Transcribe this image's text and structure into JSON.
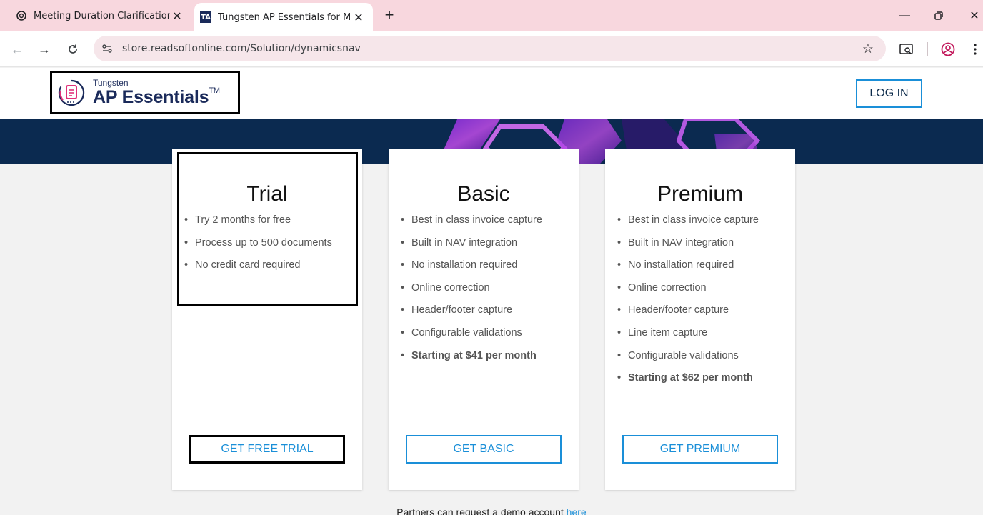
{
  "browser": {
    "tabs": [
      {
        "title": "Meeting Duration Clarification",
        "favicon": "chatgpt-icon",
        "active": false
      },
      {
        "title": "Tungsten AP Essentials for Micr",
        "favicon": "ta-favicon",
        "favicon_text": "TA",
        "active": true
      }
    ],
    "url": "store.readsoftonline.com/Solution/dynamicsnav"
  },
  "header": {
    "logo_small": "Tungsten",
    "logo_big": "AP Essentials",
    "logo_tm": "TM",
    "login_label": "LOG IN"
  },
  "plans": [
    {
      "title": "Trial",
      "features": [
        "Try 2 months for free",
        "Process up to 500 documents",
        "No credit card required"
      ],
      "button": "GET FREE TRIAL"
    },
    {
      "title": "Basic",
      "features": [
        "Best in class invoice capture",
        "Built in NAV integration",
        "No installation required",
        "Online correction",
        "Header/footer capture",
        "Configurable validations"
      ],
      "price": "Starting at $41 per month",
      "button": "GET BASIC"
    },
    {
      "title": "Premium",
      "features": [
        "Best in class invoice capture",
        "Built in NAV integration",
        "No installation required",
        "Online correction",
        "Header/footer capture",
        "Line item capture",
        "Configurable validations"
      ],
      "price": "Starting at $62 per month",
      "button": "GET PREMIUM"
    }
  ],
  "partners": {
    "text": "Partners can request a demo account ",
    "link": "here"
  },
  "colors": {
    "accent": "#1a8fd8",
    "hero_bg": "#0b2a50",
    "tabbar_bg": "#f8d7de"
  }
}
